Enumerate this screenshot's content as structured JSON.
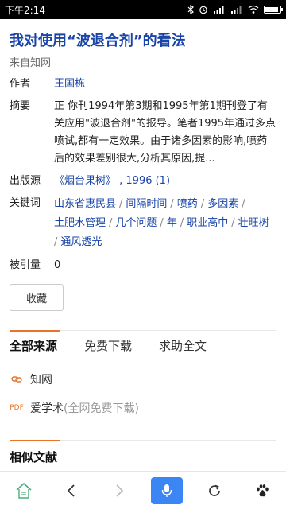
{
  "status_bar": {
    "time": "下午2:14",
    "battery_level_pct": 90
  },
  "article": {
    "title": "我对使用“波退合剂”的看法",
    "source_line": "来自知网"
  },
  "meta": {
    "author_label": "作者",
    "author_name": "王国栋",
    "abstract_label": "摘要",
    "abstract_text": "正 你刊1994年第3期和1995年第1期刊登了有关应用\"波退合剂\"的报导。笔者1995年通过多点喷试,都有一定效果。由于诸多因素的影响,喷药后的效果差别很大,分析其原因,提...",
    "published_label": "出版源",
    "published_text": "《烟台果树》 , 1996 (1)",
    "keywords_label": "关键词",
    "keywords": [
      "山东省惠民县",
      "间隔时间",
      "喷药",
      "多因素",
      "土肥水管理",
      "几个问题",
      "年",
      "职业高中",
      "壮旺树",
      "通风透光"
    ],
    "cited_label": "被引量",
    "cited_value": "0"
  },
  "actions": {
    "favorite_label": "收藏"
  },
  "tabs": {
    "items": [
      "全部来源",
      "免费下载",
      "求助全文"
    ],
    "active_index": 0
  },
  "sources": {
    "items": [
      {
        "name": "知网",
        "note": "",
        "icon": "link-icon"
      },
      {
        "name": "爱学术",
        "note": "(全网免费下载)",
        "icon": "pdf-icon"
      }
    ]
  },
  "similar": {
    "title": "相似文献"
  },
  "bottom_nav": {
    "items": [
      "home-icon",
      "back-icon",
      "forward-icon",
      "mic-icon",
      "refresh-icon",
      "paw-icon"
    ],
    "accent_color": "#3b85f5"
  },
  "colors": {
    "link": "#1a45a8",
    "accent": "#e8742a"
  }
}
